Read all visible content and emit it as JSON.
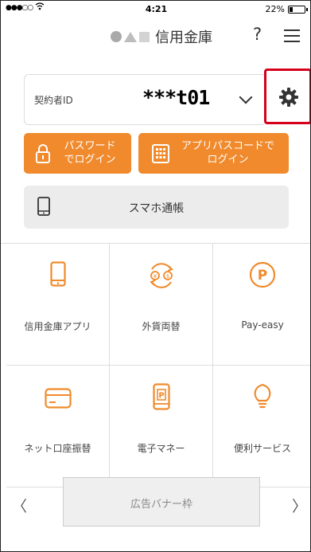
{
  "status_bar": {
    "signal": "●●●○○",
    "wifi": "wifi-icon",
    "time": "4:21",
    "battery_percent": "22%",
    "battery_level": 0.22
  },
  "header": {
    "bank_name": "信用金庫",
    "help_label": "?",
    "menu_icon": "hamburger-menu-icon"
  },
  "login": {
    "contract_id_label": "契約者ID",
    "contract_id_value": "***t01",
    "settings_icon": "gear-icon",
    "password_login_line1": "パスワード",
    "password_login_line2": "でログイン",
    "app_passcode_line1": "アプリパスコードで",
    "app_passcode_line2": "ログイン"
  },
  "passbook": {
    "label": "スマホ通帳",
    "icon": "smartphone-icon"
  },
  "menu_grid": [
    {
      "label": "信用金庫アプリ",
      "icon": "smartphone-icon"
    },
    {
      "label": "外貨両替",
      "icon": "currency-exchange-icon"
    },
    {
      "label": "Pay-easy",
      "icon": "pay-easy-icon"
    },
    {
      "label": "ネット口座振替",
      "icon": "card-icon"
    },
    {
      "label": "電子マネー",
      "icon": "e-money-icon"
    },
    {
      "label": "便利サービス",
      "icon": "lightbulb-icon"
    }
  ],
  "banner": {
    "label": "広告バナー枠",
    "prev": "〈",
    "next": "〉"
  },
  "colors": {
    "accent": "#f08a2c",
    "highlight": "#d6001c",
    "divider": "#dddddd"
  }
}
